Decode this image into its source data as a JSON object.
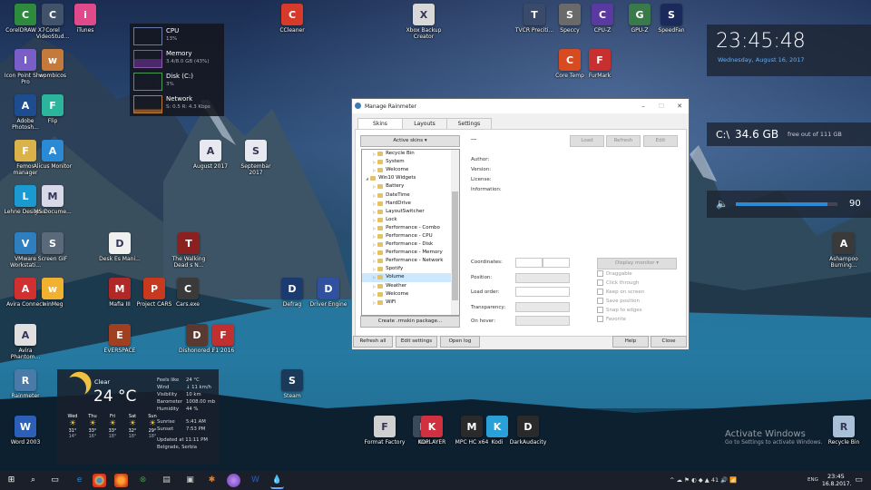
{
  "desktop_icons": [
    {
      "label": "CorelDRAW X7",
      "icon": "coreldraw-icon",
      "color": "#2e8b3d"
    },
    {
      "label": "Corel VideoStud...",
      "icon": "videostudio-icon",
      "color": "#40536a"
    },
    {
      "label": "iTunes",
      "icon": "itunes-icon",
      "color": "#e04a8a"
    },
    {
      "label": "Icon Point Shop Pro",
      "icon": "sphere-icon",
      "color": "#7a5ec8"
    },
    {
      "label": "wombicos",
      "icon": "lock-icon",
      "color": "#c47a3a"
    },
    {
      "label": "Adobe Photosh...",
      "icon": "photoshop-icon",
      "color": "#1e4d8f"
    },
    {
      "label": "Flip",
      "icon": "flip-icon",
      "color": "#2bb59d"
    },
    {
      "label": "Femos manager",
      "icon": "folder-icon",
      "color": "#d9b24a"
    },
    {
      "label": "Alicus Monitor",
      "icon": "monitor-icon",
      "color": "#2a8ad6"
    },
    {
      "label": "Lehne Designer",
      "icon": "designer-icon",
      "color": "#1a9ad0"
    },
    {
      "label": "MS Docume...",
      "icon": "document-icon",
      "color": "#d8d8e8"
    },
    {
      "label": "VMware Workstati...",
      "icon": "vmware-icon",
      "color": "#2d7fc0"
    },
    {
      "label": "Screen GIF",
      "icon": "screengif-icon",
      "color": "#5a6a7a"
    },
    {
      "label": "Avira Connect",
      "icon": "avira-icon",
      "color": "#d03030"
    },
    {
      "label": "winMeg",
      "icon": "smiley-icon",
      "color": "#f0b030"
    },
    {
      "label": "Avira Phantom...",
      "icon": "phantom-icon",
      "color": "#e0e0e0"
    },
    {
      "label": "Rainmeter",
      "icon": "rainmeter-icon",
      "color": "#4a7aa8"
    },
    {
      "label": "Word 2003",
      "icon": "word-icon",
      "color": "#2b5fb8"
    },
    {
      "label": "CCleaner",
      "icon": "ccleaner-icon",
      "color": "#d83a2a"
    },
    {
      "label": "Xbox Backup Creator",
      "icon": "disc-icon",
      "color": "#d8d8d8"
    },
    {
      "label": "August 2017",
      "icon": "document-icon",
      "color": "#e8e8f0"
    },
    {
      "label": "Septembar 2017",
      "icon": "document-icon",
      "color": "#e8e8f0"
    },
    {
      "label": "Desk Es Mani...",
      "icon": "document-icon",
      "color": "#f0f0f0"
    },
    {
      "label": "The Walking Dead s N...",
      "icon": "game-icon",
      "color": "#8a2020"
    },
    {
      "label": "Mafia III",
      "icon": "mafia-icon",
      "color": "#b02828"
    },
    {
      "label": "Project CARS",
      "icon": "cars-icon",
      "color": "#c83a20"
    },
    {
      "label": "Cars.exe",
      "icon": "cars2-icon",
      "color": "#3a3a3a"
    },
    {
      "label": "EVERSPACE",
      "icon": "everspace-icon",
      "color": "#a04020"
    },
    {
      "label": "Dishonored 2",
      "icon": "dishonored-icon",
      "color": "#5a3a30"
    },
    {
      "label": "F1 2016",
      "icon": "f1-icon",
      "color": "#c03030"
    },
    {
      "label": "Steam",
      "icon": "steam-icon",
      "color": "#1b3a5a"
    },
    {
      "label": "Defrag",
      "icon": "defrag-icon",
      "color": "#1a3a70"
    },
    {
      "label": "Driver Engine",
      "icon": "driver-icon",
      "color": "#3050a0"
    },
    {
      "label": "Nox",
      "icon": "nox-icon",
      "color": "#3a4a5a"
    },
    {
      "label": "Format Factory",
      "icon": "factory-icon",
      "color": "#d0d0d0"
    },
    {
      "label": "KOPLAYER",
      "icon": "koplayer-icon",
      "color": "#d03040"
    },
    {
      "label": "MPC HC x64",
      "icon": "mpc-icon",
      "color": "#2a2a2a"
    },
    {
      "label": "Kodi",
      "icon": "kodi-icon",
      "color": "#2aa0d8"
    },
    {
      "label": "DarkAudacity",
      "icon": "audacity-icon",
      "color": "#2a2a2a"
    },
    {
      "label": "TVCR Preciti...",
      "icon": "tv-icon",
      "color": "#3a4a6a"
    },
    {
      "label": "Speccy",
      "icon": "speccy-icon",
      "color": "#6a6a6a"
    },
    {
      "label": "CPU-Z",
      "icon": "cpuz-icon",
      "color": "#5a3aa0"
    },
    {
      "label": "GPU-Z",
      "icon": "gpuz-icon",
      "color": "#3a7a4a"
    },
    {
      "label": "SpeedFan",
      "icon": "fan-icon",
      "color": "#1a2a5a"
    },
    {
      "label": "Core Temp",
      "icon": "coretemp-icon",
      "color": "#d84a20"
    },
    {
      "label": "FurMark",
      "icon": "furmark-icon",
      "color": "#c83030"
    },
    {
      "label": "Ashampoo Burning...",
      "icon": "burning-icon",
      "color": "#3a3a3a"
    },
    {
      "label": "Recycle Bin",
      "icon": "recycle-bin-icon",
      "color": "#a8c0d8"
    }
  ],
  "perf": {
    "cpu": {
      "name": "CPU",
      "value": "13%"
    },
    "memory": {
      "name": "Memory",
      "value": "3.4/8.0 GB (43%)"
    },
    "disk": {
      "name": "Disk (C:)",
      "value": "3%"
    },
    "network": {
      "name": "Network",
      "value": "S: 0.5 R: 4.3 Kbps"
    }
  },
  "clock_widget": {
    "time": "23:45:48",
    "date": "Wednesday, August 16, 2017"
  },
  "disk_widget": {
    "drive": "C:\\",
    "size": "34.6 GB",
    "note": "free out of 111 GB"
  },
  "volume_widget": {
    "value": "90",
    "level": 0.9
  },
  "weather": {
    "condition": "Clear",
    "temp": "24 °C",
    "feels_like_label": "Feels like",
    "feels_like": "24 °C",
    "wind_label": "Wind",
    "wind": "↓ 11 km/h",
    "visibility_label": "Visibility",
    "visibility": "10 km",
    "barometer_label": "Barometer",
    "barometer": "1008.00 mb",
    "humidity_label": "Humidity",
    "humidity": "44 %",
    "sunrise_label": "Sunrise",
    "sunrise": "5:41 AM",
    "sunset_label": "Sunset",
    "sunset": "7:53 PM",
    "updated": "Updated at 11:11 PM",
    "location": "Belgrade, Serbia",
    "days": [
      {
        "d": "Wed",
        "hi": "31°",
        "lo": "14°"
      },
      {
        "d": "Thu",
        "hi": "33°",
        "lo": "16°"
      },
      {
        "d": "Fri",
        "hi": "33°",
        "lo": "18°"
      },
      {
        "d": "Sat",
        "hi": "32°",
        "lo": "18°"
      },
      {
        "d": "Sun",
        "hi": "29°",
        "lo": "18°"
      }
    ]
  },
  "dialog": {
    "title": "Manage Rainmeter",
    "tabs": [
      "Skins",
      "Layouts",
      "Settings"
    ],
    "active_skins_btn": "Active skins",
    "ellipsis": "...",
    "load_btn": "Load",
    "refresh_btn": "Refresh",
    "edit_btn": "Edit",
    "info_labels": [
      "Author:",
      "Version:",
      "License:",
      "Information:"
    ],
    "tree": [
      {
        "t": "Recycle Bin",
        "lvl": 1
      },
      {
        "t": "System",
        "lvl": 1
      },
      {
        "t": "Welcome",
        "lvl": 1
      },
      {
        "t": "Win10 Widgets",
        "lvl": 0
      },
      {
        "t": "Battery",
        "lvl": 1
      },
      {
        "t": "DateTime",
        "lvl": 1
      },
      {
        "t": "HardDrive",
        "lvl": 1
      },
      {
        "t": "LayoutSwitcher",
        "lvl": 1
      },
      {
        "t": "Lock",
        "lvl": 1
      },
      {
        "t": "Performance - Combo",
        "lvl": 1
      },
      {
        "t": "Performance - CPU",
        "lvl": 1
      },
      {
        "t": "Performance - Disk",
        "lvl": 1
      },
      {
        "t": "Performance - Memory",
        "lvl": 1
      },
      {
        "t": "Performance - Network",
        "lvl": 1
      },
      {
        "t": "Spotify",
        "lvl": 1
      },
      {
        "t": "Volume",
        "lvl": 1,
        "sel": true
      },
      {
        "t": "Weather",
        "lvl": 1
      },
      {
        "t": "Welcome",
        "lvl": 1
      },
      {
        "t": "WiFi",
        "lvl": 1
      }
    ],
    "create_btn": "Create .rmskin package...",
    "coords_label": "Coordinates:",
    "position_label": "Position:",
    "load_order_label": "Load order:",
    "transparency_label": "Transparency:",
    "on_hover_label": "On hover:",
    "display_monitor_btn": "Display monitor",
    "checks": [
      "Draggable",
      "Click through",
      "Keep on screen",
      "Save position",
      "Snap to edges",
      "Favorite"
    ],
    "bottom_buttons": [
      "Refresh all",
      "Edit settings",
      "Open log"
    ],
    "help_btn": "Help",
    "close_btn": "Close"
  },
  "watermark": {
    "title": "Activate Windows",
    "sub": "Go to Settings to activate Windows."
  },
  "taskbar": {
    "time": "23:45",
    "date": "16.8.2017.",
    "lang": "ENG",
    "tray": "^ ☁ ⚑ ◐ ◆ ▲ 41 🔊 📶"
  }
}
